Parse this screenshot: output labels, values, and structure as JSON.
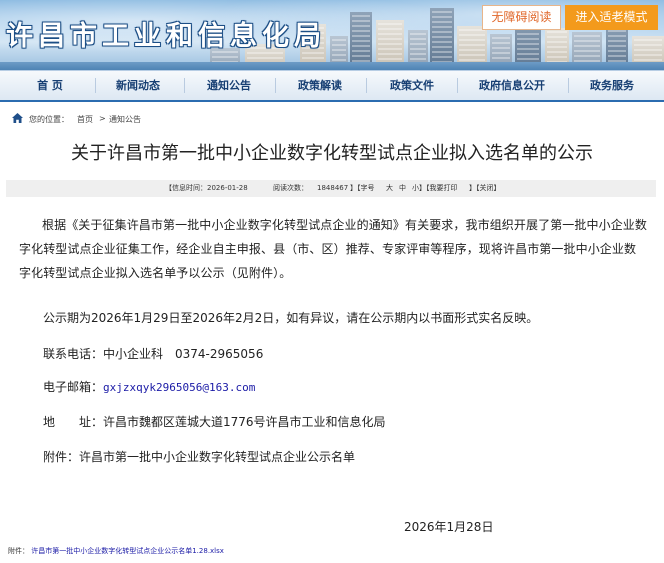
{
  "header": {
    "site_title": "许昌市工业和信息化局",
    "btn_accessibility": "无障碍阅读",
    "btn_elder": "进入适老模式"
  },
  "nav": {
    "items": [
      "首 页",
      "新闻动态",
      "通知公告",
      "政策解读",
      "政策文件",
      "政府信息公开",
      "政务服务"
    ]
  },
  "breadcrumb": {
    "prefix": "您的位置：",
    "home": "首页",
    "separator": ">",
    "current": "通知公告"
  },
  "article": {
    "title": "关于许昌市第一批中小企业数字化转型试点企业拟入选名单的公示",
    "meta": {
      "date_text": "【信息时间：2026-01-28",
      "views_text": "阅读次数：",
      "views_count": "1848467",
      "font_prefix": "】【字号",
      "font_large": "大",
      "font_medium": "中",
      "font_small": "小",
      "print_text": "】【我要打印",
      "close_text": "】【关闭】"
    },
    "para1": "根据《关于征集许昌市第一批中小企业数字化转型试点企业的通知》有关要求，我市组织开展了第一批中小企业数字化转型试点企业征集工作，经企业自主申报、县（市、区）推荐、专家评审等程序，现将许昌市第一批中小企业数字化转型试点企业拟入选名单予以公示（见附件）。",
    "para2": "公示期为2026年1月29日至2026年2月2日，如有异议，请在公示期内以书面形式实名反映。",
    "contact_label": "联系电话：",
    "contact_value": "中小企业科　0374-2965056",
    "email_label": "电子邮箱：",
    "email_value": "gxjzxqyk2965056@163.com",
    "address_label": "地　　址：",
    "address_value": "许昌市魏都区莲城大道1776号许昌市工业和信息化局",
    "attachment_line": "附件：许昌市第一批中小企业数字化转型试点企业公示名单",
    "date_sign": "2026年1月28日"
  },
  "attachment_bar": {
    "label": "附件：",
    "file": "许昌市第一批中小企业数字化转型试点企业公示名单1.28.xlsx"
  },
  "colors": {
    "nav_text": "#173f73",
    "nav_border": "#2b6cb0",
    "elder_button": "#f39a1c",
    "link": "#1a1aa6"
  }
}
